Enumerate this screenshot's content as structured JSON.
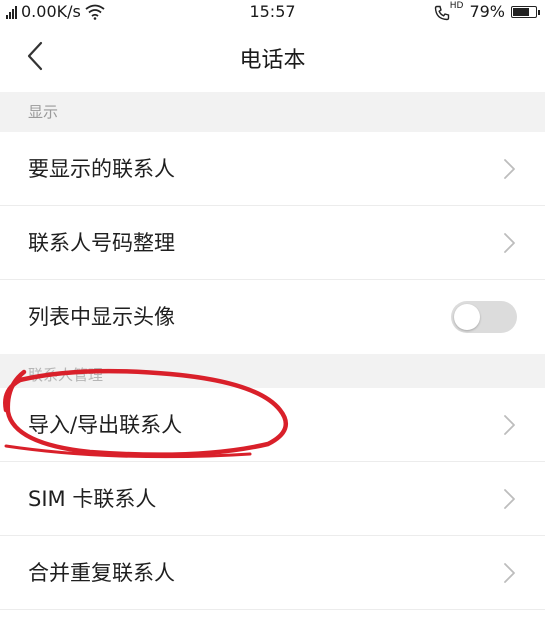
{
  "status_bar": {
    "network_speed": "0.00K/s",
    "time": "15:57",
    "hd_label": "HD",
    "battery": "79%",
    "battery_level": 0.79
  },
  "nav": {
    "title": "电话本"
  },
  "sections": {
    "display": {
      "header": "显示",
      "items": [
        {
          "label": "要显示的联系人"
        },
        {
          "label": "联系人号码整理"
        },
        {
          "label": "列表中显示头像",
          "toggle_on": false
        }
      ]
    },
    "management": {
      "header": "联系人管理",
      "items": [
        {
          "label": "导入/导出联系人"
        },
        {
          "label": "SIM 卡联系人"
        },
        {
          "label": "合并重复联系人"
        }
      ]
    }
  },
  "colors": {
    "annotation": "#d9202a",
    "section_bg": "#f2f2f2",
    "toggle_off": "#dcdcdc"
  }
}
